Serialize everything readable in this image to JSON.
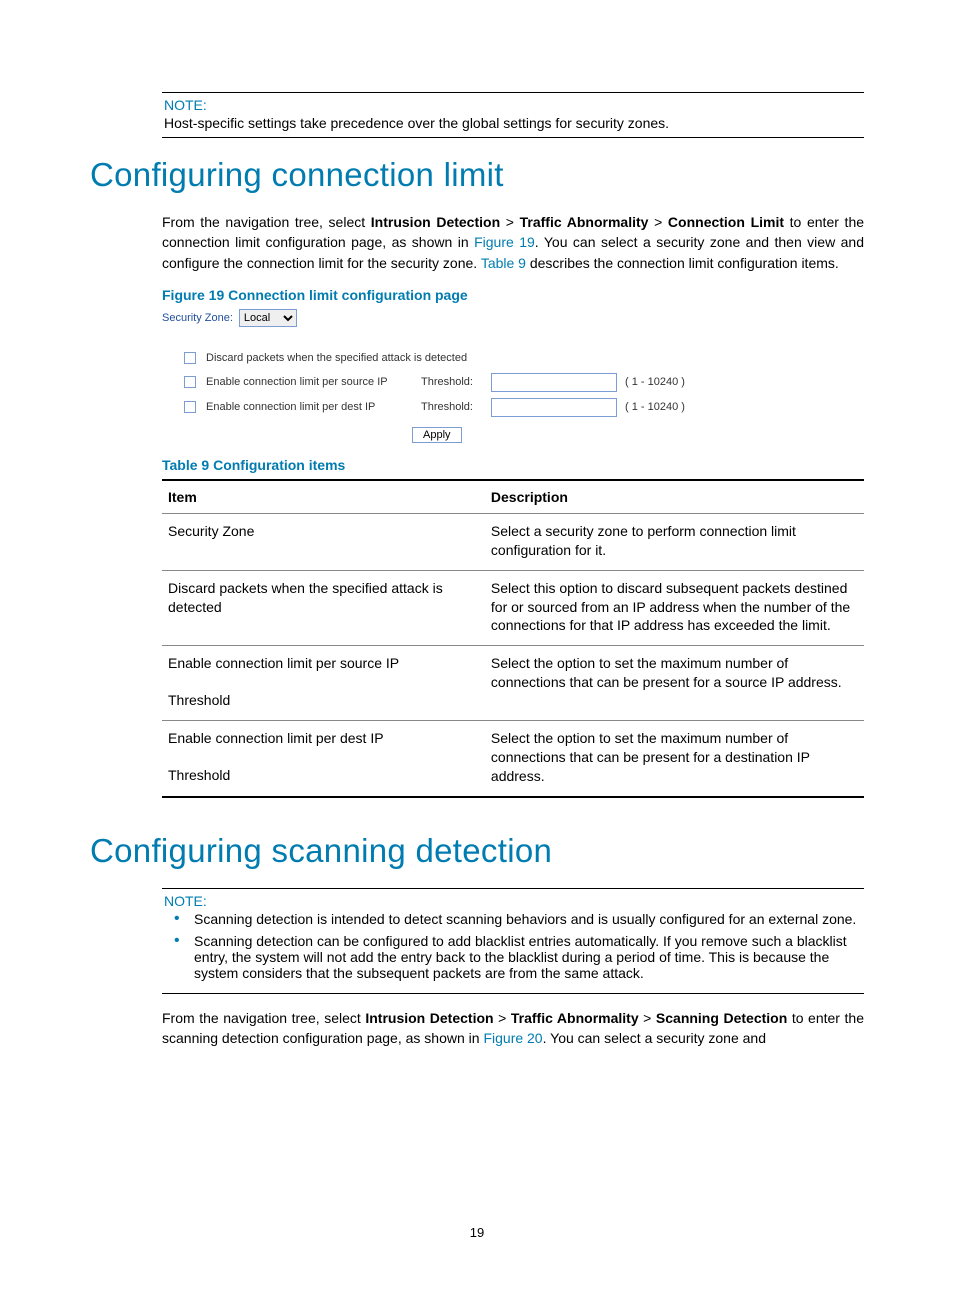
{
  "note1": {
    "label": "NOTE:",
    "text": "Host-specific settings take precedence over the global settings for security zones."
  },
  "h1_a": "Configuring connection limit",
  "para1": {
    "pre": "From the navigation tree, select ",
    "b1": "Intrusion Detection",
    "gt1": " > ",
    "b2": "Traffic Abnormality",
    "gt2": " > ",
    "b3": "Connection Limit",
    "mid1": " to enter the connection limit configuration page, as shown in ",
    "link1": "Figure 19",
    "mid2": ". You can select a security zone and then view and configure the connection limit for the security zone. ",
    "link2": "Table 9",
    "tail": " describes the connection limit configuration items."
  },
  "fig19": {
    "caption": "Figure 19 Connection limit configuration page",
    "sz_label": "Security Zone:",
    "sz_value": "Local",
    "cb1": "Discard packets when the specified attack is detected",
    "cb2": "Enable connection limit per source IP",
    "cb3": "Enable connection limit per dest IP",
    "threshold_label": "Threshold:",
    "hint": "( 1 - 10240 )",
    "apply": "Apply"
  },
  "table9": {
    "caption": "Table 9 Configuration items",
    "head_item": "Item",
    "head_desc": "Description",
    "rows": {
      "r1_item": "Security Zone",
      "r1_desc": "Select a security zone to perform connection limit configuration for it.",
      "r2_item": "Discard packets when the specified attack is detected",
      "r2_desc": "Select this option to discard subsequent packets destined for or sourced from an IP address when the number of the connections for that IP address has exceeded the limit.",
      "r3_item": "Enable connection limit per source IP",
      "r4_item": "Threshold",
      "r3_desc": "Select the option to set the maximum number of connections that can be present for a source IP address.",
      "r5_item": "Enable connection limit per dest IP",
      "r6_item": "Threshold",
      "r5_desc": "Select the option to set the maximum number of connections that can be present for a destination IP address."
    }
  },
  "h1_b": "Configuring scanning detection",
  "note2": {
    "label": "NOTE:",
    "li1": "Scanning detection is intended to detect scanning behaviors and is usually configured for an external zone.",
    "li2": "Scanning detection can be configured to add blacklist entries automatically. If you remove such a blacklist entry, the system will not add the entry back to the blacklist during a period of time. This is because the system considers that the subsequent packets are from the same attack."
  },
  "para2": {
    "pre": "From the navigation tree, select ",
    "b1": "Intrusion Detection",
    "gt1": " > ",
    "b2": "Traffic Abnormality",
    "gt2": " > ",
    "b3": "Scanning Detection",
    "mid1": " to enter the scanning detection configuration page, as shown in ",
    "link1": "Figure 20",
    "tail": ". You can select a security zone and"
  },
  "page_number": "19"
}
